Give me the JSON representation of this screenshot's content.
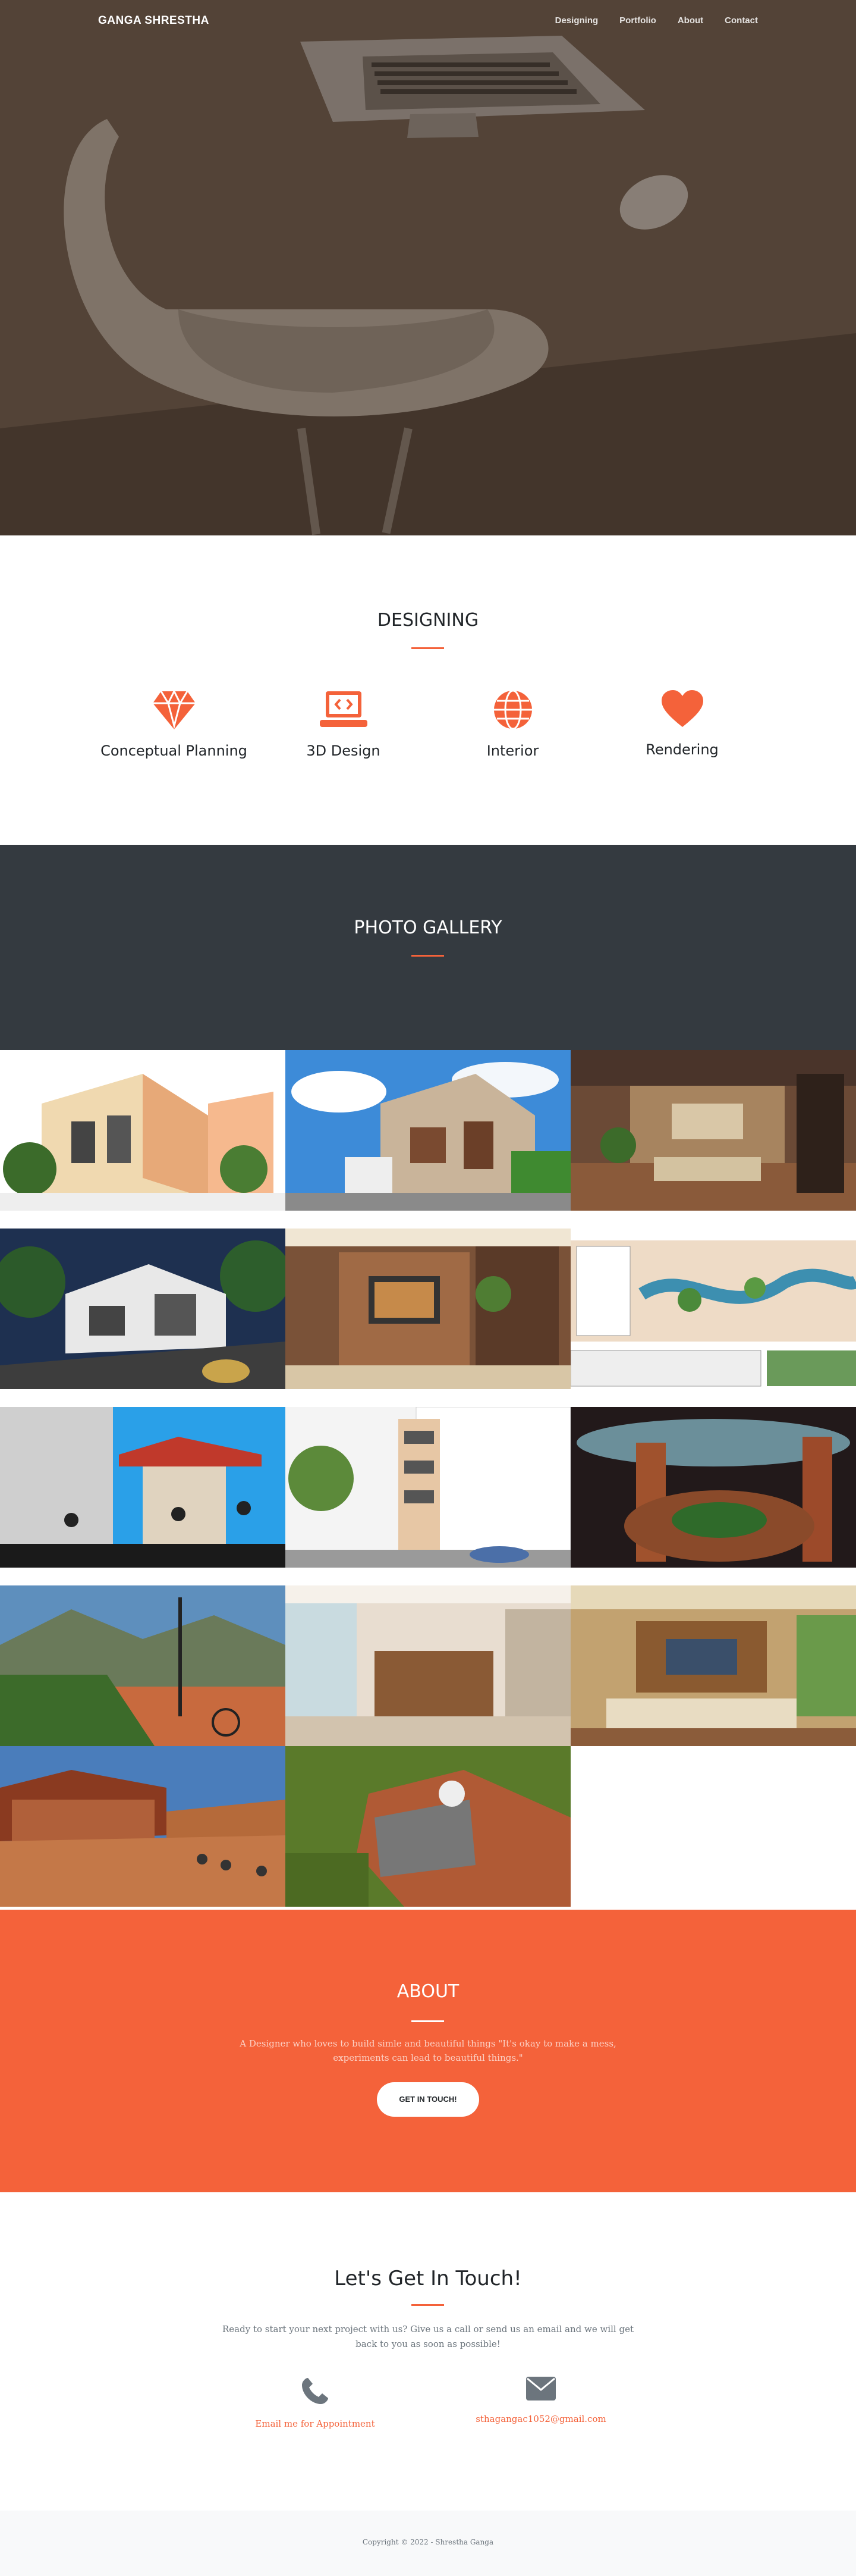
{
  "nav": {
    "brand": "GANGA SHRESTHA",
    "links": [
      "Designing",
      "Portfolio",
      "About",
      "Contact"
    ]
  },
  "designing": {
    "title": "DESIGNING",
    "services": [
      {
        "icon": "gem-icon",
        "label": "Conceptual Planning"
      },
      {
        "icon": "laptop-code-icon",
        "label": "3D Design"
      },
      {
        "icon": "globe-icon",
        "label": "Interior"
      },
      {
        "icon": "heart-icon",
        "label": "Rendering"
      }
    ]
  },
  "gallery": {
    "title": "PHOTO GALLERY",
    "item_count": 14
  },
  "about": {
    "title": "ABOUT",
    "text": "A Designer who loves to build simle and beautiful things \"It's okay to make a mess, experiments can lead to beautiful things.\"",
    "button": "GET IN TOUCH!"
  },
  "contact": {
    "title": "Let's Get In Touch!",
    "text": "Ready to start your next project with us? Give us a call or send us an email and we will get back to you as soon as possible!",
    "phone_label": "Email me for Appointment",
    "email": "sthagangac1052@gmail.com"
  },
  "footer": {
    "copyright": "Copyright © 2022 - Shrestha Ganga"
  },
  "colors": {
    "accent": "#f4623a",
    "dark": "#343a40"
  }
}
